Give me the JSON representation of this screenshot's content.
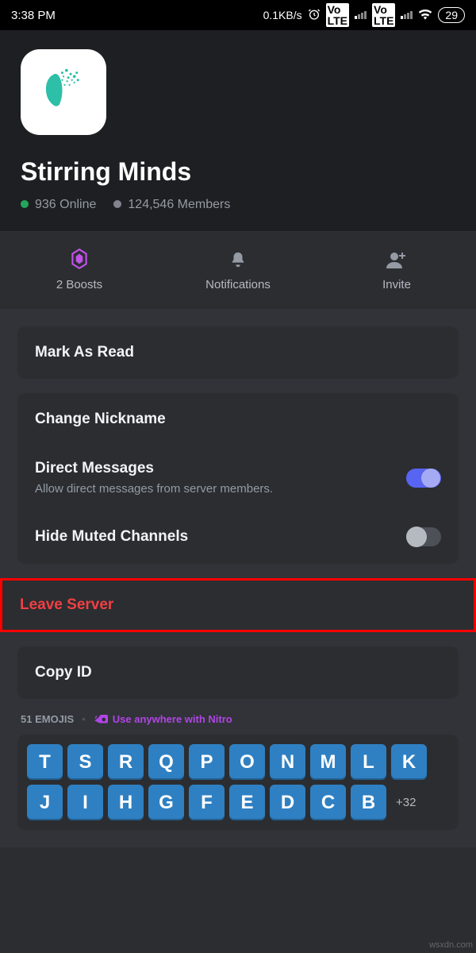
{
  "status": {
    "time": "3:38 PM",
    "net_speed": "0.1KB/s",
    "battery": "29"
  },
  "server": {
    "name": "Stirring Minds",
    "online": "936 Online",
    "members": "124,546 Members"
  },
  "actions": {
    "boosts": "2 Boosts",
    "notifications": "Notifications",
    "invite": "Invite"
  },
  "options": {
    "mark_as_read": "Mark As Read",
    "change_nickname": "Change Nickname",
    "direct_messages": "Direct Messages",
    "dm_sub": "Allow direct messages from server members.",
    "hide_muted": "Hide Muted Channels",
    "leave_server": "Leave Server",
    "copy_id": "Copy ID"
  },
  "emojis": {
    "header": "51 EMOJIS",
    "nitro_prompt": "Use anywhere with Nitro",
    "tiles": [
      "T",
      "S",
      "R",
      "Q",
      "P",
      "O",
      "N",
      "M",
      "L",
      "K",
      "J",
      "I",
      "H",
      "G",
      "F",
      "E",
      "D",
      "C",
      "B"
    ],
    "more": "+32"
  },
  "watermark": "wsxdn.com"
}
